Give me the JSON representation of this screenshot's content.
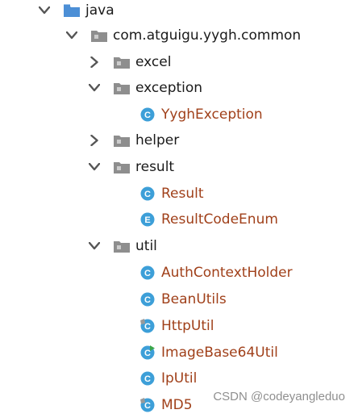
{
  "tree": {
    "rows": [
      {
        "id": "java",
        "label": "java",
        "kind": "source-folder",
        "expander": "expanded"
      },
      {
        "id": "common",
        "label": "com.atguigu.yygh.common",
        "kind": "package",
        "expander": "expanded"
      },
      {
        "id": "excel",
        "label": "excel",
        "kind": "package",
        "expander": "collapsed"
      },
      {
        "id": "exception",
        "label": "exception",
        "kind": "package",
        "expander": "expanded"
      },
      {
        "id": "yyghexception",
        "label": "YyghException",
        "kind": "class",
        "icon_letter": "C"
      },
      {
        "id": "helper",
        "label": "helper",
        "kind": "package",
        "expander": "collapsed"
      },
      {
        "id": "result-pkg",
        "label": "result",
        "kind": "package",
        "expander": "expanded"
      },
      {
        "id": "result",
        "label": "Result",
        "kind": "class",
        "icon_letter": "C"
      },
      {
        "id": "resultcodeenum",
        "label": "ResultCodeEnum",
        "kind": "enum",
        "icon_letter": "E"
      },
      {
        "id": "util",
        "label": "util",
        "kind": "package",
        "expander": "expanded"
      },
      {
        "id": "authcontextholder",
        "label": "AuthContextHolder",
        "kind": "class",
        "icon_letter": "C"
      },
      {
        "id": "beanutils",
        "label": "BeanUtils",
        "kind": "class",
        "icon_letter": "C"
      },
      {
        "id": "httputil",
        "label": "HttpUtil",
        "kind": "class",
        "icon_letter": "C",
        "badge": "abstract-gray"
      },
      {
        "id": "imagebase64util",
        "label": "ImageBase64Util",
        "kind": "class",
        "icon_letter": "C",
        "badge": "run-green"
      },
      {
        "id": "iputil",
        "label": "IpUtil",
        "kind": "class",
        "icon_letter": "C"
      },
      {
        "id": "md5",
        "label": "MD5",
        "kind": "class",
        "icon_letter": "C",
        "badge": "abstract-gray"
      }
    ]
  },
  "watermark": {
    "text": "CSDN @codeyangleduo"
  },
  "colors": {
    "class_text": "#a0401a",
    "class_icon": "#3d9fd8",
    "folder_blue": "#4c8fd6",
    "package_gray": "#8e8e8e",
    "chevron": "#555555"
  }
}
